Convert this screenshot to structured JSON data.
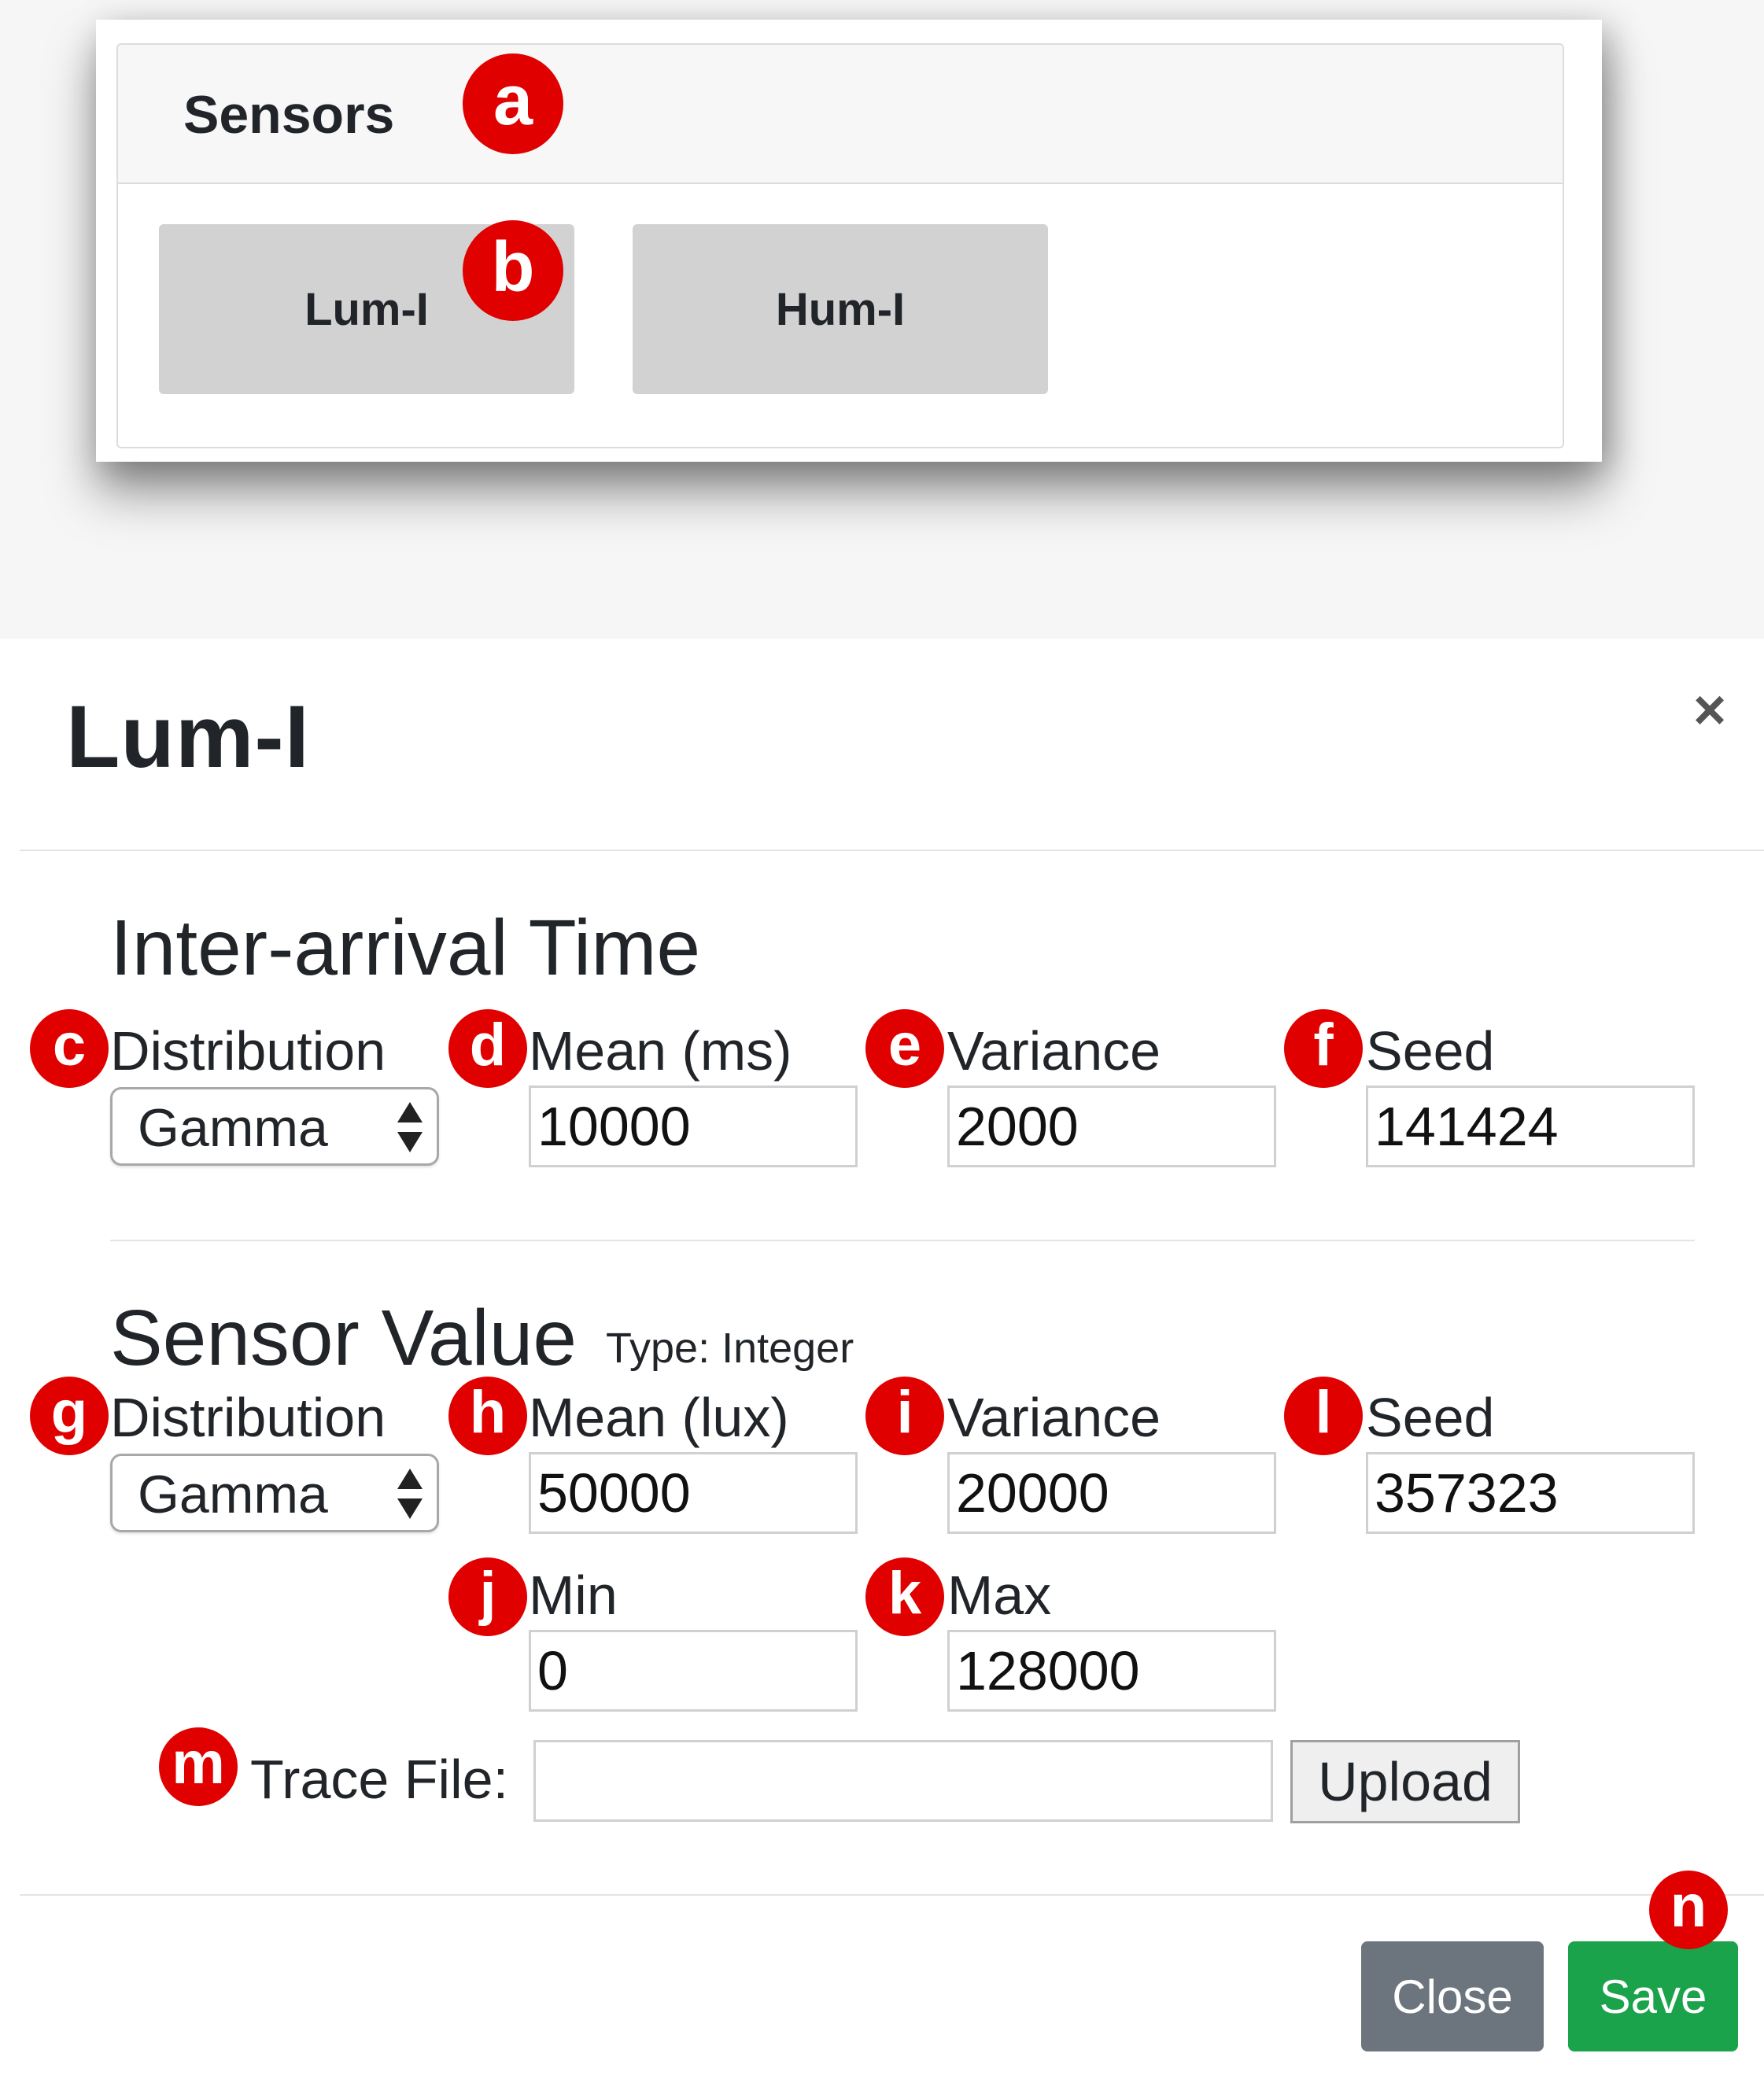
{
  "sensors_panel": {
    "title": "Sensors",
    "buttons": [
      "Lum-I",
      "Hum-I"
    ]
  },
  "callouts": [
    "a",
    "b",
    "c",
    "d",
    "e",
    "f",
    "g",
    "h",
    "i",
    "j",
    "k",
    "l",
    "m",
    "n"
  ],
  "modal": {
    "title": "Lum-I",
    "close_symbol": "×",
    "inter_arrival": {
      "heading": "Inter-arrival Time",
      "distribution_label": "Distribution",
      "distribution_value": "Gamma",
      "mean_label": "Mean (ms)",
      "mean_value": "10000",
      "variance_label": "Variance",
      "variance_value": "2000",
      "seed_label": "Seed",
      "seed_value": "141424"
    },
    "sensor_value": {
      "heading": "Sensor Value",
      "type_text": "Type: Integer",
      "distribution_label": "Distribution",
      "distribution_value": "Gamma",
      "mean_label": "Mean (lux)",
      "mean_value": "50000",
      "variance_label": "Variance",
      "variance_value": "20000",
      "seed_label": "Seed",
      "seed_value": "357323",
      "min_label": "Min",
      "min_value": "0",
      "max_label": "Max",
      "max_value": "128000"
    },
    "trace": {
      "label": "Trace File:",
      "value": "",
      "upload_label": "Upload"
    },
    "footer": {
      "close_label": "Close",
      "save_label": "Save"
    }
  },
  "colors": {
    "callout_red": "#e00000",
    "close_button": "#6c757d",
    "save_button": "#1aa34a",
    "sensor_button": "#d2d2d2"
  }
}
